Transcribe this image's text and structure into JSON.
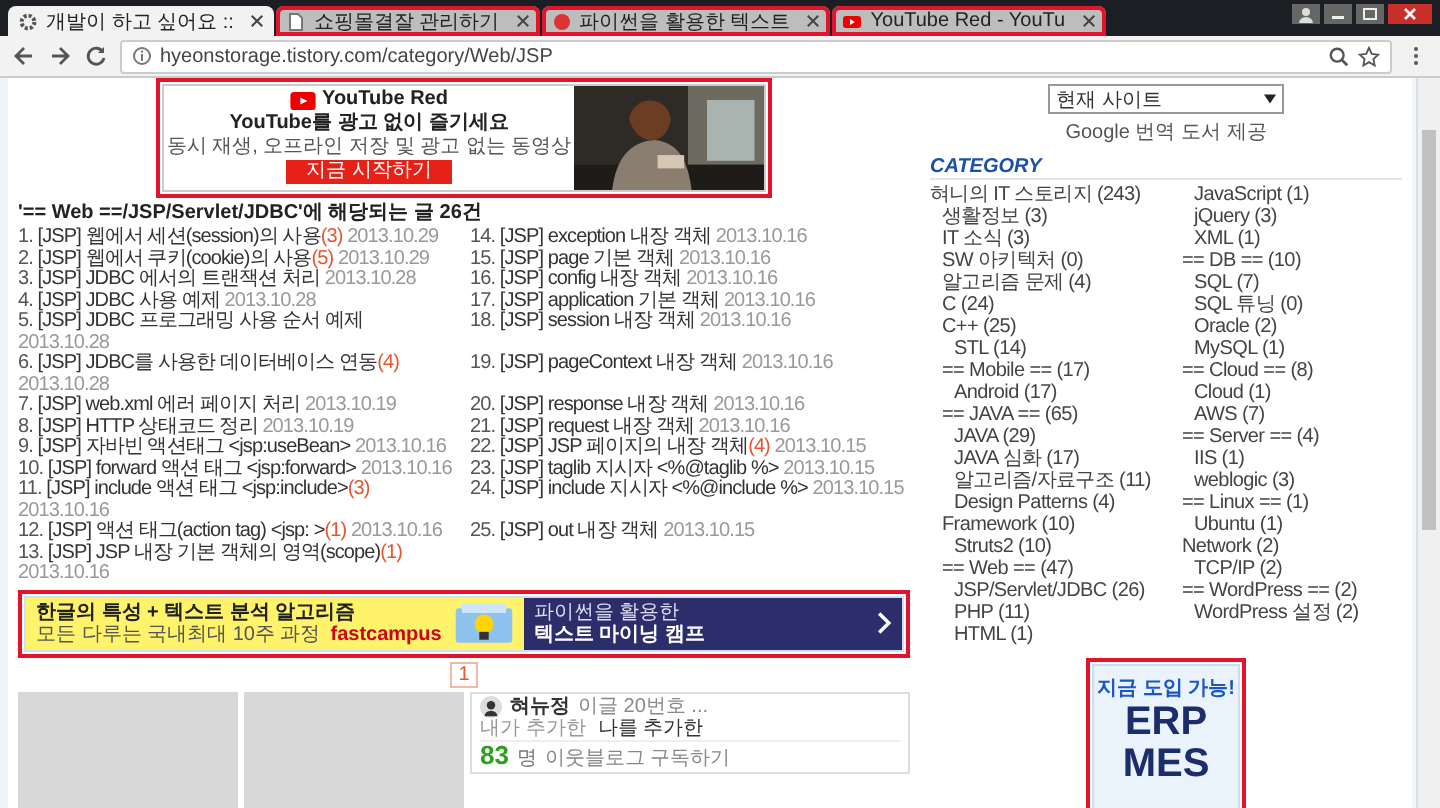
{
  "browser": {
    "tabs": [
      {
        "title": "개발이 하고 싶어요 ::",
        "selected": true,
        "highlighted": false,
        "kind": "blog"
      },
      {
        "title": "쇼핑몰결잘 관리하기",
        "selected": false,
        "highlighted": true,
        "kind": "page"
      },
      {
        "title": "파이썬을 활용한 텍스트",
        "selected": false,
        "highlighted": true,
        "kind": "site"
      },
      {
        "title": "YouTube Red - YouTu",
        "selected": false,
        "highlighted": true,
        "kind": "video"
      }
    ],
    "address": "hyeonstorage.tistory.com/category/Web/JSP"
  },
  "top_ad": {
    "highlighted": true,
    "brand": "YouTube Red",
    "headline": "YouTube를 광고 없이 즐기세요",
    "body": "동시 재생, 오프라인 저장 및 광고 없는 동영상",
    "button": "지금 시작하기"
  },
  "heading": "'== Web ==/JSP/Servlet/JDBC'에 해당되는 글 26건",
  "posts": [
    {
      "number": "1.",
      "title": "[JSP] 웹에서 세션(session)의 사용",
      "comments": "(3)",
      "date": "2013.10.29"
    },
    {
      "number": "2.",
      "title": "[JSP] 웹에서 쿠키(cookie)의 사용",
      "comments": "(5)",
      "date": "2013.10.29"
    },
    {
      "number": "3.",
      "title": "[JSP] JDBC 에서의 트랜잭션 처리",
      "date": "2013.10.28"
    },
    {
      "number": "4.",
      "title": "[JSP] JDBC 사용 예제",
      "date": "2013.10.28"
    },
    {
      "number": "5.",
      "title": "[JSP] JDBC 프로그래밍 사용 순서 예제",
      "date": "2013.10.28"
    },
    {
      "number": "6.",
      "title": "[JSP] JDBC를 사용한 데이터베이스 연동",
      "comments": "(4)",
      "date": "2013.10.28"
    },
    {
      "number": "7.",
      "title": "[JSP] web.xml 에러 페이지 처리",
      "date": "2013.10.19"
    },
    {
      "number": "8.",
      "title": "[JSP] HTTP 상태코드 정리",
      "date": "2013.10.19"
    },
    {
      "number": "9.",
      "title": "[JSP] 자바빈 액션태그 <jsp:useBean>",
      "date": "2013.10.16"
    },
    {
      "number": "10.",
      "title": "[JSP] forward 액션 태그 <jsp:forward>",
      "date": "2013.10.16"
    },
    {
      "number": "11.",
      "title": "[JSP] include 액션 태그 <jsp:include>",
      "comments": "(3)",
      "date": "2013.10.16"
    },
    {
      "number": "12.",
      "title": "[JSP] 액션 태그(action tag) <jsp: >",
      "comments": "(1)",
      "date": "2013.10.16"
    },
    {
      "number": "13.",
      "title": "[JSP] JSP 내장 기본 객체의 영역(scope)",
      "comments": "(1)",
      "date": "2013.10.16"
    },
    {
      "number": "14.",
      "title": "[JSP] exception 내장 객체",
      "date": "2013.10.16"
    },
    {
      "number": "15.",
      "title": "[JSP] page 기본 객체",
      "date": "2013.10.16"
    },
    {
      "number": "16.",
      "title": "[JSP] config 내장 객체",
      "date": "2013.10.16"
    },
    {
      "number": "17.",
      "title": "[JSP] application 기본 객체",
      "date": "2013.10.16"
    },
    {
      "number": "18.",
      "title": "[JSP] session 내장 객체",
      "date": "2013.10.16"
    },
    {
      "number": "19.",
      "title": "[JSP] pageContext 내장 객체",
      "date": "2013.10.16"
    },
    {
      "number": "20.",
      "title": "[JSP] response 내장 객체",
      "date": "2013.10.16"
    },
    {
      "number": "21.",
      "title": "[JSP] request 내장 객체",
      "date": "2013.10.16"
    },
    {
      "number": "22.",
      "title": "[JSP] JSP 페이지의 내장 객체",
      "comments": "(4)",
      "date": "2013.10.15"
    },
    {
      "number": "23.",
      "title": "[JSP] taglib 지시자 <%@taglib %>",
      "date": "2013.10.15"
    },
    {
      "number": "24.",
      "title": "[JSP] include 지시자 <%@include %>",
      "date": "2013.10.15"
    },
    {
      "number": "25.",
      "title": "[JSP] out 내장 객체",
      "date": "2013.10.15"
    }
  ],
  "banner_ad": {
    "highlighted": true,
    "headline": "한글의 특성 + 텍스트 분석 알고리즘",
    "subline": "모든 다루는 국내최대 10주 과정",
    "brand": "fastcampus",
    "cta_top": "파이썬을 활용한",
    "cta_main": "텍스트 마이닝 캠프"
  },
  "pagination": [
    {
      "label": "1",
      "selected": true
    }
  ],
  "thumbnails": [
    {
      "kind": "blank"
    },
    {
      "kind": "blank"
    }
  ],
  "profile": {
    "name": "혀뉴정",
    "subtitle": "이글 20번호 ...",
    "tab_following": "내가 추가한",
    "tab_followers": "나를 추가한",
    "count": "83",
    "unit": "명",
    "link": "이웃블로그 구독하기"
  },
  "sidebar": {
    "search_select": "현재 사이트",
    "translate": "Google 번역 도서 제공",
    "category_title": "CATEGORY",
    "categories": [
      {
        "label": "혀니의 IT 스토리지 (243)",
        "children": [
          {
            "label": "생활정보 (3)"
          },
          {
            "label": "IT 소식 (3)"
          },
          {
            "label": "SW 아키텍처 (0)"
          },
          {
            "label": "알고리즘 문제 (4)"
          },
          {
            "label": "C (24)"
          },
          {
            "label": "C++ (25)",
            "children": [
              {
                "label": "STL (14)"
              }
            ]
          },
          {
            "label": "== Mobile == (17)",
            "children": [
              {
                "label": "Android (17)"
              }
            ]
          },
          {
            "label": "== JAVA == (65)",
            "children": [
              {
                "label": "JAVA (29)"
              },
              {
                "label": "JAVA 심화 (17)"
              },
              {
                "label": "알고리즘/자료구조 (11)"
              },
              {
                "label": "Design Patterns (4)"
              }
            ]
          },
          {
            "label": "Framework (10)",
            "children": [
              {
                "label": "Struts2 (10)"
              }
            ]
          },
          {
            "label": "== Web == (47)",
            "children": [
              {
                "label": "JSP/Servlet/JDBC (26)"
              },
              {
                "label": "PHP (11)"
              },
              {
                "label": "HTML (1)"
              },
              {
                "label": "JavaScript (1)"
              },
              {
                "label": "jQuery (3)"
              },
              {
                "label": "XML (1)"
              }
            ]
          },
          {
            "label": "== DB == (10)",
            "children": [
              {
                "label": "SQL (7)"
              },
              {
                "label": "SQL 튜닝 (0)"
              },
              {
                "label": "Oracle (2)"
              },
              {
                "label": "MySQL (1)"
              }
            ]
          },
          {
            "label": "== Cloud == (8)",
            "children": [
              {
                "label": "Cloud (1)"
              },
              {
                "label": "AWS (7)"
              }
            ]
          },
          {
            "label": "== Server == (4)",
            "children": [
              {
                "label": "IIS (1)"
              },
              {
                "label": "weblogic (3)"
              }
            ]
          },
          {
            "label": "== Linux == (1)",
            "children": [
              {
                "label": "Ubuntu (1)"
              }
            ]
          },
          {
            "label": "Network (2)",
            "children": [
              {
                "label": "TCP/IP (2)"
              }
            ]
          },
          {
            "label": "== WordPress == (2)",
            "children": [
              {
                "label": "WordPress 설정 (2)"
              }
            ]
          }
        ]
      }
    ],
    "side_ad": {
      "highlighted": true,
      "headline": "지금 도입 가능!",
      "line1": "ERP",
      "line2": "MES"
    }
  }
}
